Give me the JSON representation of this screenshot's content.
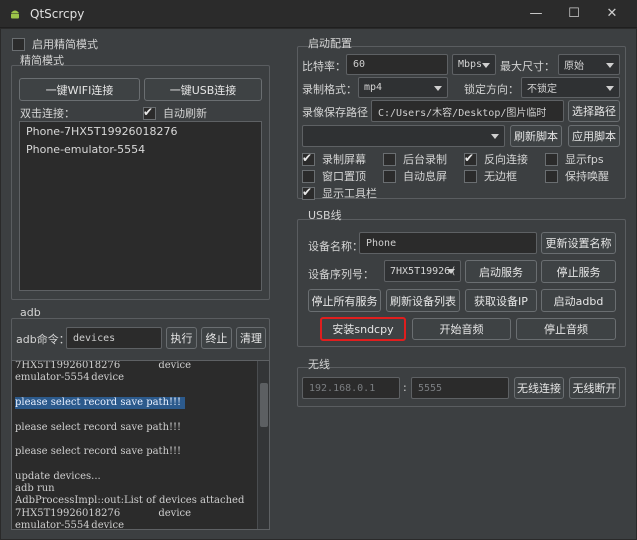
{
  "window": {
    "title": "QtScrcpy",
    "icon": "android-icon",
    "controls": {
      "minimize": "—",
      "maximize": "☐",
      "close": "✕"
    }
  },
  "simple_mode": {
    "enable_label": "启用精简模式",
    "enabled": false,
    "group_title": "精简模式",
    "wifi_button": "一键WIFI连接",
    "usb_button": "一键USB连接",
    "double_click_label": "双击连接：",
    "auto_refresh_label": "自动刷新",
    "auto_refresh": true,
    "devices": [
      "Phone-7HX5T19926018276",
      "Phone-emulator-5554"
    ]
  },
  "adb": {
    "group_title": "adb",
    "command_label": "adb命令：",
    "command_value": "devices",
    "execute": "执行",
    "stop": "终止",
    "clear": "清理",
    "log_lines": [
      {
        "text": "7HX5T19926018276            device",
        "selected": false
      },
      {
        "text": "emulator-5554\tdevice",
        "selected": false
      },
      {
        "text": "",
        "selected": false
      },
      {
        "text": "please select record save path!!!",
        "selected": true
      },
      {
        "text": "",
        "selected": false
      },
      {
        "text": "please select record save path!!!",
        "selected": false
      },
      {
        "text": "",
        "selected": false
      },
      {
        "text": "please select record save path!!!",
        "selected": false
      },
      {
        "text": "",
        "selected": false
      },
      {
        "text": "update devices...",
        "selected": false
      },
      {
        "text": "adb run",
        "selected": false
      },
      {
        "text": "AdbProcessImpl::out:List of devices attached",
        "selected": false
      },
      {
        "text": "7HX5T19926018276            device",
        "selected": false
      },
      {
        "text": "emulator-5554\tdevice",
        "selected": false
      }
    ]
  },
  "start_config": {
    "group_title": "启动配置",
    "bitrate_label": "比特率：",
    "bitrate_value": "60",
    "bitrate_unit": "Mbps",
    "max_size_label": "最大尺寸：",
    "max_size_value": "原始",
    "record_format_label": "录制格式：",
    "record_format_value": "mp4",
    "lock_orientation_label": "锁定方向：",
    "lock_orientation_value": "不锁定",
    "record_path_label": "录像保存路径",
    "record_path_value": "C:/Users/木容/Desktop/图片临时",
    "select_path_button": "选择路径",
    "script_value": "",
    "refresh_script_button": "刷新脚本",
    "apply_script_button": "应用脚本",
    "options": [
      {
        "label": "录制屏幕",
        "checked": true
      },
      {
        "label": "后台录制",
        "checked": false
      },
      {
        "label": "反向连接",
        "checked": true
      },
      {
        "label": "显示fps",
        "checked": false
      },
      {
        "label": "窗口置顶",
        "checked": false
      },
      {
        "label": "自动息屏",
        "checked": false
      },
      {
        "label": "无边框",
        "checked": false
      },
      {
        "label": "保持唤醒",
        "checked": false
      },
      {
        "label": "显示工具栏",
        "checked": true
      }
    ]
  },
  "usb": {
    "group_title": "USB线",
    "device_name_label": "设备名称：",
    "device_name_value": "Phone",
    "update_name_button": "更新设置名称",
    "serial_label": "设备序列号：",
    "serial_value": "7HX5T19926(",
    "start_service_button": "启动服务",
    "stop_service_button": "停止服务",
    "stop_all_button": "停止所有服务",
    "refresh_list_button": "刷新设备列表",
    "get_ip_button": "获取设备IP",
    "start_adbd_button": "启动adbd",
    "install_sndcpy_button": "安装sndcpy",
    "start_audio_button": "开始音频",
    "stop_audio_button": "停止音频"
  },
  "wireless": {
    "group_title": "无线",
    "ip_placeholder": "192.168.0.1",
    "port_placeholder": "5555",
    "separator": ":",
    "connect_button": "无线连接",
    "disconnect_button": "无线断开"
  }
}
